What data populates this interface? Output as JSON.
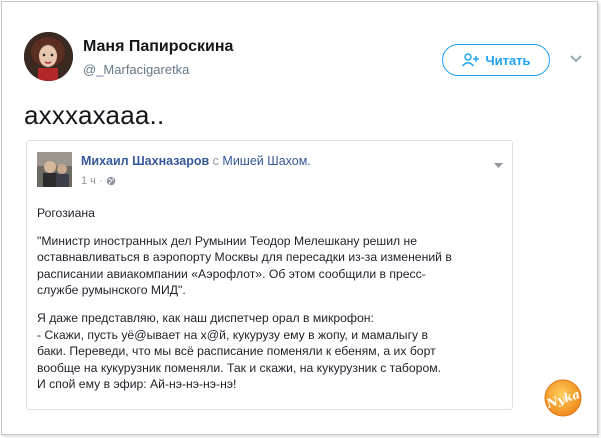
{
  "tweet": {
    "display_name": "Маня Папироскина",
    "handle": "@_Marfacigaretka",
    "follow_label": "Читать",
    "text": "ахххахааа.."
  },
  "quoted_post": {
    "author": "Михаил Шахназаров",
    "with_prefix": "с",
    "tagged": "Мишей Шахом.",
    "time": "1 ч",
    "dot": "·",
    "paragraphs": [
      "Рогозиана",
      "\"Министр иностранных дел Румынии Теодор Мелешкану решил не\nоставнавливаться в аэропорту Москвы для пересадки из-за изменений в\nрасписании авиакомпании «Аэрофлот». Об этом сообщили в пресс-\nслужбе румынского МИД\".",
      "Я даже представляю, как наш диспетчер орал в микрофон:\n- Скажи, пусть уё@ывает на х@й, кукурузу ему в жопу, и мамалыгу в\nбаки. Переведи, что мы всё расписание поменяли к ебеням, а их борт\nвообще на кукурузник поменяли. Так и скажи, на кукурузник с табором.\nИ спой ему в эфир: Ай-нэ-нэ-нэ-нэ!"
    ]
  },
  "watermark_text": "Nyka",
  "colors": {
    "twitter_blue": "#1da1f2",
    "fb_link": "#365899",
    "muted": "#657786"
  },
  "icons": [
    "follow-person-icon",
    "chevron-down-icon",
    "globe-icon"
  ]
}
